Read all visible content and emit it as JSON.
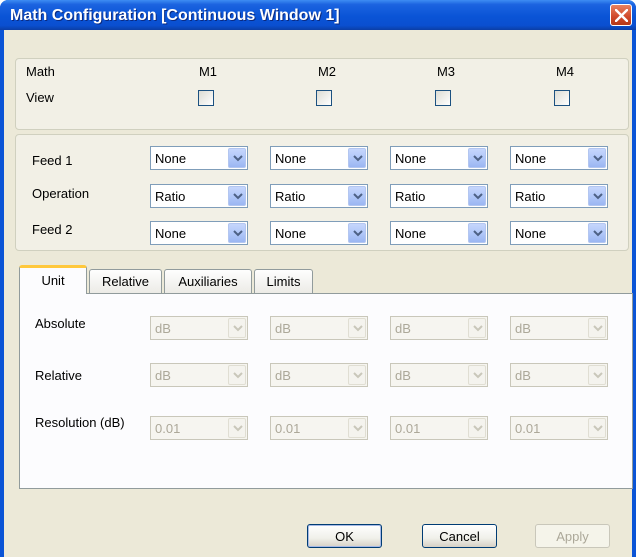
{
  "window": {
    "title": "Math Configuration [Continuous Window 1]"
  },
  "math_header": {
    "label": "Math",
    "view_label": "View",
    "columns": [
      "M1",
      "M2",
      "M3",
      "M4"
    ]
  },
  "feed": {
    "rows": [
      {
        "label": "Feed 1",
        "values": [
          "None",
          "None",
          "None",
          "None"
        ]
      },
      {
        "label": "Operation",
        "values": [
          "Ratio",
          "Ratio",
          "Ratio",
          "Ratio"
        ]
      },
      {
        "label": "Feed 2",
        "values": [
          "None",
          "None",
          "None",
          "None"
        ]
      }
    ]
  },
  "tabs": [
    "Unit",
    "Relative",
    "Auxiliaries",
    "Limits"
  ],
  "unit": {
    "rows": [
      {
        "label": "Absolute",
        "values": [
          "dB",
          "dB",
          "dB",
          "dB"
        ]
      },
      {
        "label": "Relative",
        "values": [
          "dB",
          "dB",
          "dB",
          "dB"
        ]
      },
      {
        "label": "Resolution (dB)",
        "values": [
          "0.01",
          "0.01",
          "0.01",
          "0.01"
        ]
      }
    ]
  },
  "buttons": {
    "ok": "OK",
    "cancel": "Cancel",
    "apply": "Apply"
  },
  "colors": {
    "titlebar": "#0a54d6",
    "dialog_face": "#ece9d8",
    "active_tab_accent": "#ffc83c"
  },
  "icons": {
    "close": "close-icon",
    "dropdown": "chevron-down-icon"
  }
}
